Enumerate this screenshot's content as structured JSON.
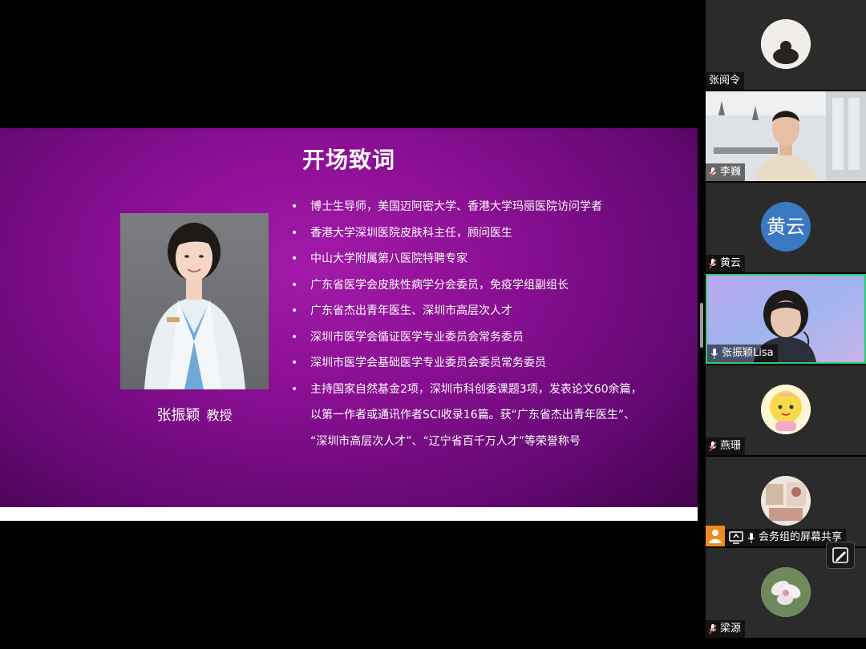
{
  "slide": {
    "title": "开场致词",
    "speaker_name": "张振颖",
    "speaker_title": "教授",
    "bullets": [
      "博士生导师，美国迈阿密大学、香港大学玛丽医院访问学者",
      "香港大学深圳医院皮肤科主任，顾问医生",
      "中山大学附属第八医院特聘专家",
      "广东省医学会皮肤性病学分会委员，免疫学组副组长",
      "广东省杰出青年医生、深圳市高层次人才",
      "深圳市医学会循证医学专业委员会常务委员",
      "深圳市医学会基础医学专业委员会委员常务委员"
    ],
    "last_bullet_lines": [
      "主持国家自然基金2项，深圳市科创委课题3项，发表论文60余篇，",
      "以第一作者或通讯作者SCI收录16篇。获“广东省杰出青年医生”、",
      "“深圳市高层次人才”、“辽宁省百千万人才”等荣誉称号"
    ]
  },
  "participants": [
    {
      "name": "张阅令",
      "mic": false,
      "avatar": "photo-avatar"
    },
    {
      "name": "李巍",
      "mic": "muted",
      "avatar": "video"
    },
    {
      "name": "黄云",
      "mic": "muted",
      "avatar_text": "黄云"
    },
    {
      "name": "张振颖Lisa",
      "mic": "on",
      "avatar": "video",
      "active": true
    },
    {
      "name": "燕珊",
      "mic": "muted",
      "avatar": "cartoon-avatar"
    },
    {
      "name": "会务组的屏幕共享",
      "mic": "on",
      "sharing": true,
      "avatar": "photo-avatar"
    },
    {
      "name": "梁源",
      "mic": "muted",
      "avatar": "flower-avatar"
    }
  ],
  "colors": {
    "slide_purple": "#8a0f93",
    "active_border": "#2ecc71",
    "text_avatar_bg": "#3a78c2",
    "share_badge": "#f08a1c"
  }
}
